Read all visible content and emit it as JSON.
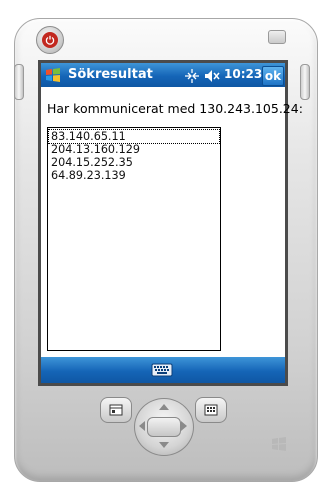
{
  "window": {
    "title": "Sökresultat",
    "clock": "10:23",
    "ok_label": "ok"
  },
  "content": {
    "heading": "Har kommunicerat med 130.243.105.24:",
    "results": [
      "83.140.65.11",
      "204.13.160.129",
      "204.15.252.35",
      "64.89.23.139"
    ],
    "selected_index": 0
  },
  "icons": {
    "start": "windows-start-icon",
    "connectivity": "connectivity-icon",
    "volume": "volume-muted-icon",
    "keyboard": "keyboard-icon",
    "power": "power-icon",
    "windows_key": "windows-logo-icon"
  },
  "colors": {
    "titlebar": "#1565b7",
    "power_button": "#c2281f",
    "screen_bg": "#ffffff"
  }
}
